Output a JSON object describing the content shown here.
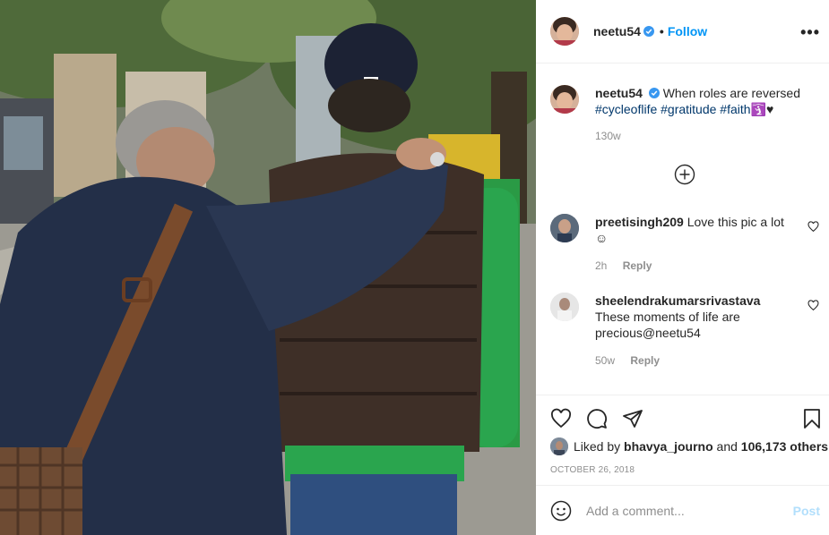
{
  "post": {
    "username": "neetu54",
    "follow_label": "Follow",
    "dot": "•",
    "more_label": "•••"
  },
  "caption": {
    "username": "neetu54",
    "text": "When roles are reversed",
    "tags": "#cycleoflife #gratitude #faith",
    "emoji": "🛐♥",
    "time": "130w"
  },
  "comments": [
    {
      "username": "preetisingh209",
      "text": "Love this pic a lot",
      "emoji": "☺",
      "time": "2h",
      "reply_label": "Reply"
    },
    {
      "username": "sheelendrakumarsrivastava",
      "text": "These moments of life are precious@neetu54",
      "time": "50w",
      "reply_label": "Reply"
    }
  ],
  "likes": {
    "prefix": "Liked by",
    "user": "bhavya_journo",
    "and": "and",
    "count": "106,173 others"
  },
  "date": "OCTOBER 26, 2018",
  "add_comment": {
    "placeholder": "Add a comment...",
    "post_label": "Post"
  },
  "colors": {
    "link_blue": "#0095f6",
    "hashtag": "#00376b",
    "muted": "#8e8e8e",
    "post_disabled": "#b2dffc"
  },
  "icons": [
    "verified-badge-icon",
    "more-options-icon",
    "add-circle-icon",
    "heart-icon",
    "comment-icon",
    "share-icon",
    "bookmark-icon",
    "emoji-icon"
  ]
}
